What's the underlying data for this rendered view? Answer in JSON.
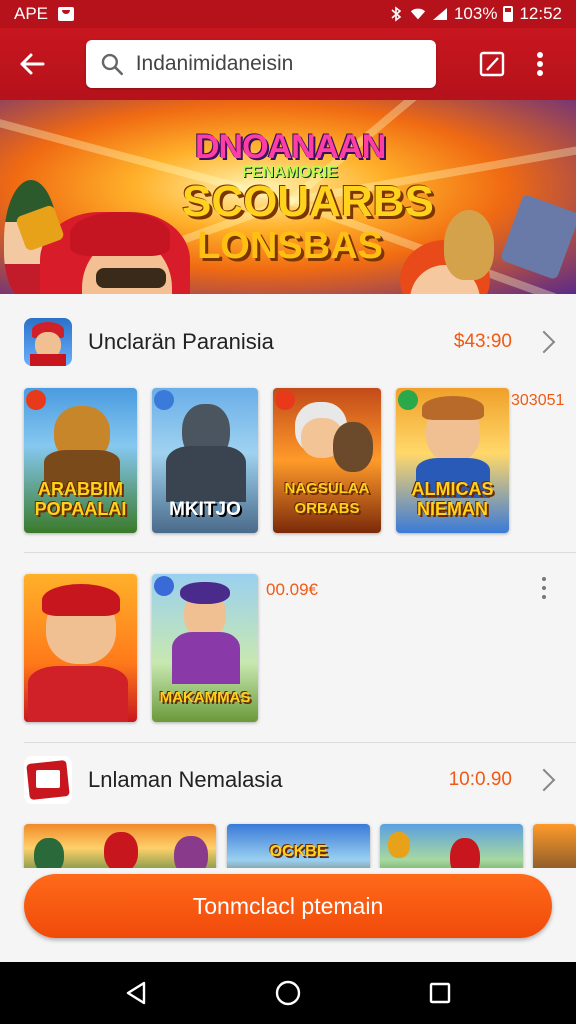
{
  "status_bar": {
    "carrier": "APE",
    "battery": "103%",
    "time": "12:52"
  },
  "app_bar": {
    "search_text": "Indanimidaneisin"
  },
  "banner": {
    "line1": "DNOANAAN",
    "line2": "FENAMORIE",
    "line3": "SCOUARBS",
    "line4": "LONSBAS"
  },
  "sections": [
    {
      "title": "Unclarän Paranisia",
      "price": "$43:90",
      "side_label": "303051",
      "cards": [
        {
          "caption": "ARABBIM POPAALAI",
          "style": "gold"
        },
        {
          "caption": "MKITJO",
          "style": "white"
        },
        {
          "caption": "NAGSULAA ORBABS",
          "style": "gold"
        },
        {
          "caption": "ALMICAS NIEMAN",
          "style": "gold"
        }
      ]
    },
    {
      "note": "00.09€",
      "cards": [
        {
          "caption": "",
          "style": "none"
        },
        {
          "caption": "MAKAMMAS",
          "style": "gold"
        }
      ]
    },
    {
      "title": "Lnlaman Nemalasia",
      "price": "10:0.90",
      "cards": [
        {
          "caption": "",
          "style": "none"
        },
        {
          "caption": "OCKBE",
          "style": "gold"
        },
        {
          "caption": "",
          "style": "none"
        },
        {
          "caption": "",
          "style": "none"
        }
      ]
    }
  ],
  "cta": {
    "label": "Tonmclacl ptemain"
  },
  "colors": {
    "primary": "#c8161f",
    "accent": "#f05a14",
    "cta": "#ff6a1a"
  }
}
